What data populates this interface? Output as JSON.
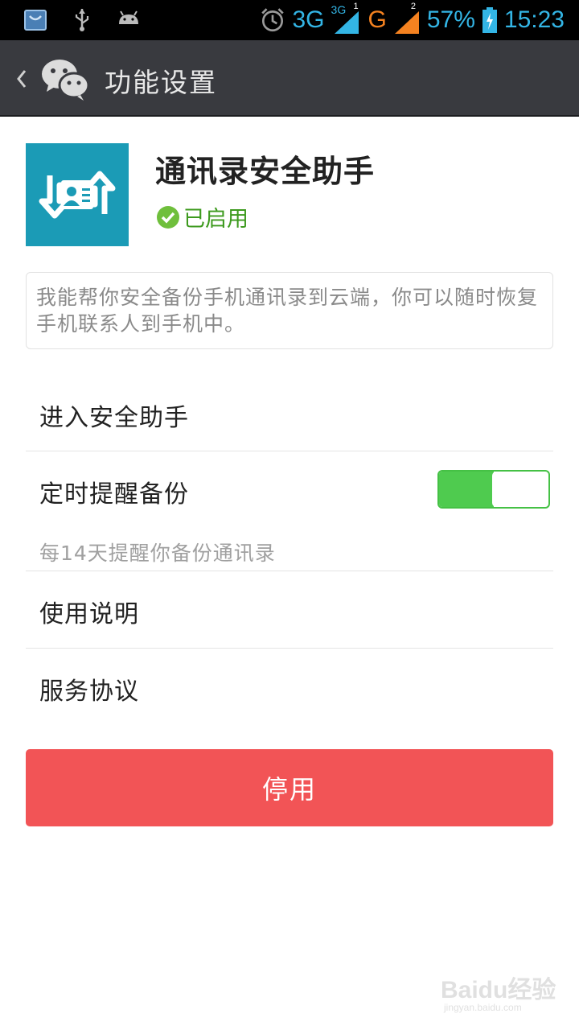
{
  "status_bar": {
    "left_icons": [
      "shopping-bag-icon",
      "usb-icon",
      "android-icon"
    ],
    "network_3g": "3G",
    "network_3g_small": "3G",
    "sim1_label": "1",
    "network_g": "G",
    "sim2_label": "2",
    "battery_percent": "57%",
    "time": "15:23",
    "colors": {
      "accent": "#33b5e5",
      "secondary": "#f58220"
    }
  },
  "app_bar": {
    "title": "功能设置",
    "background": "#393a3f"
  },
  "plugin": {
    "name": "通讯录安全助手",
    "status": "已启用",
    "icon_color": "#1b9bb6",
    "status_color": "#3d9a1e",
    "description": "我能帮你安全备份手机通讯录到云端，你可以随时恢复手机联系人到手机中。"
  },
  "menu": {
    "enter_assistant": "进入安全助手",
    "scheduled_backup": "定时提醒备份",
    "scheduled_backup_enabled": true,
    "scheduled_backup_hint": "每14天提醒你备份通讯录",
    "instructions": "使用说明",
    "service_agreement": "服务协议"
  },
  "disable_button": {
    "label": "停用",
    "color": "#f25456"
  },
  "watermark": {
    "main": "Baidu经验",
    "sub": "jingyan.baidu.com"
  }
}
